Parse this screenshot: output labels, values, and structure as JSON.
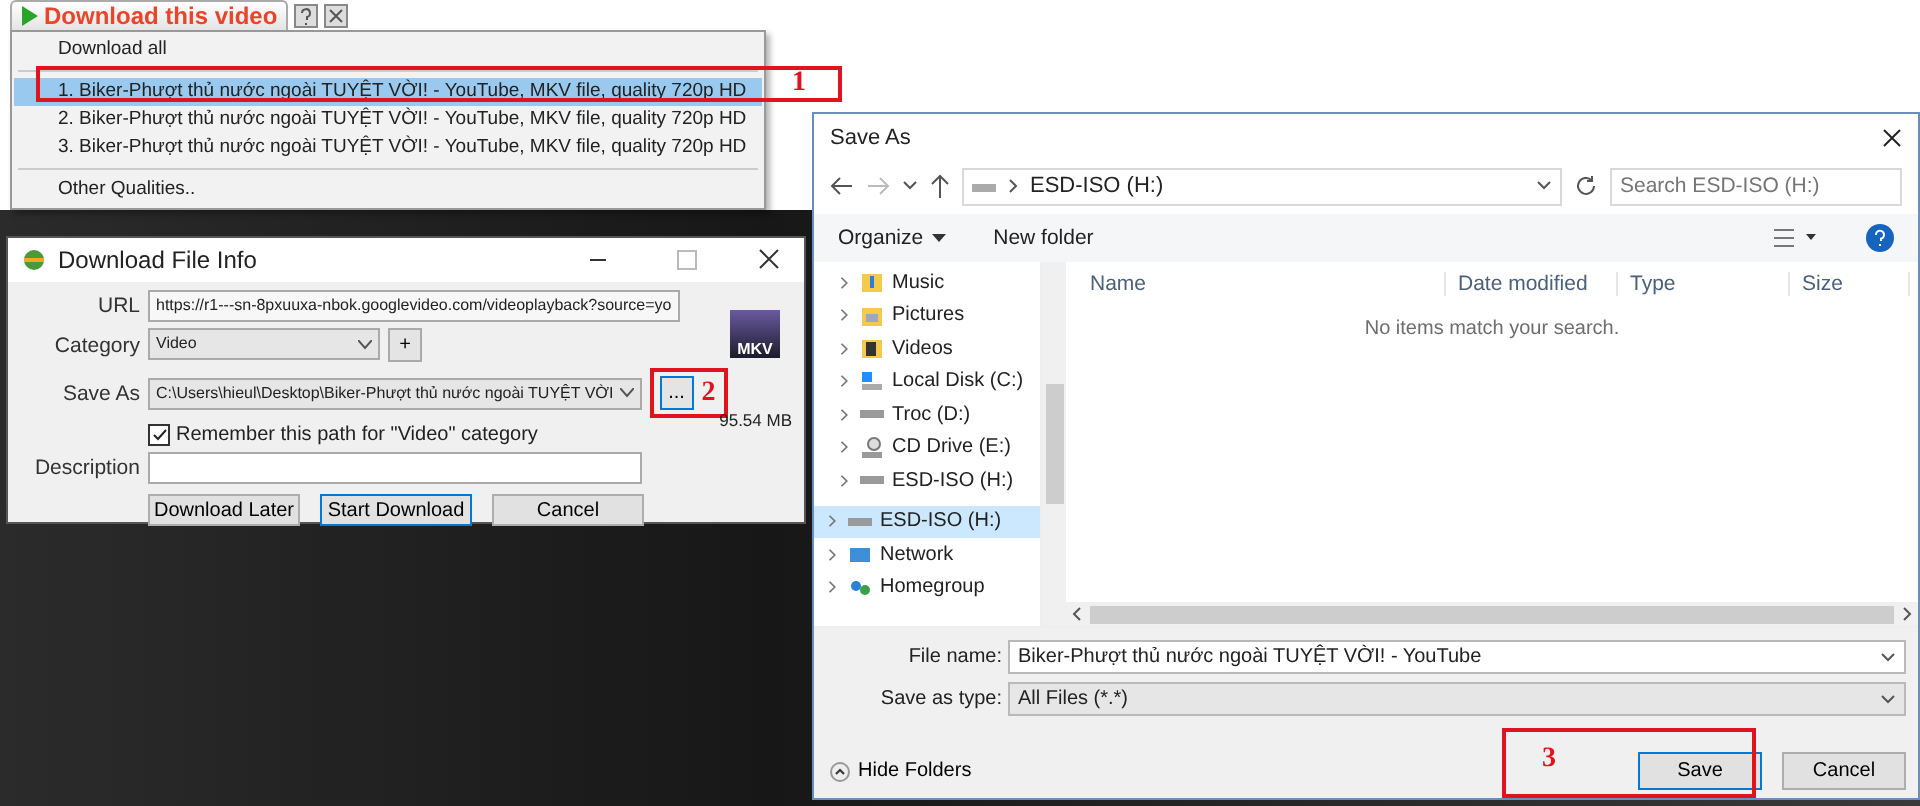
{
  "video_menu": {
    "title": "Download this video",
    "items": [
      {
        "kind": "all",
        "label": "Download all",
        "selected": false
      },
      {
        "kind": "quality",
        "label": "1.  Biker-Phượt thủ nước ngoài TUYỆT VỜI! - YouTube,  MKV file, quality 720p HD",
        "selected": true
      },
      {
        "kind": "quality",
        "label": "2.  Biker-Phượt thủ nước ngoài TUYỆT VỜI! - YouTube,  MKV file, quality 720p HD",
        "selected": false
      },
      {
        "kind": "quality",
        "label": "3.  Biker-Phượt thủ nước ngoài TUYỆT VỜI! - YouTube,  MKV file, quality 720p HD",
        "selected": false
      },
      {
        "kind": "more",
        "label": "Other Qualities..",
        "selected": false
      }
    ],
    "callout": "1"
  },
  "download_dialog": {
    "title": "Download File Info",
    "url": {
      "label": "URL",
      "value": "https://r1---sn-8pxuuxa-nbok.googlevideo.com/videoplayback?source=yo"
    },
    "category": {
      "label": "Category",
      "value": "Video",
      "add": "+"
    },
    "save_as": {
      "label": "Save As",
      "value": "C:\\Users\\hieul\\Desktop\\Biker-Phượt thủ nước ngoài TUYỆT VỜI",
      "browse": "...",
      "callout": "2"
    },
    "file_badge": "MKV",
    "size": "95.54  MB",
    "remember": {
      "label": "Remember this path for \"Video\" category",
      "checked": true
    },
    "description": {
      "label": "Description"
    },
    "buttons": [
      {
        "label": "Download Later",
        "default": false
      },
      {
        "label": "Start Download",
        "default": true
      },
      {
        "label": "Cancel",
        "default": false
      }
    ]
  },
  "save_dialog": {
    "title": "Save As",
    "path": "ESD-ISO (H:)",
    "search": {
      "placeholder": "Search ESD-ISO (H:)"
    },
    "toolbar": {
      "organize": "Organize",
      "new_folder": "New folder"
    },
    "nav_pane": {
      "children": [
        {
          "kind": "music",
          "label": "Music",
          "selected": false
        },
        {
          "kind": "pictures",
          "label": "Pictures",
          "selected": false
        },
        {
          "kind": "videos",
          "label": "Videos",
          "selected": false
        },
        {
          "kind": "system-disk",
          "label": "Local Disk (C:)",
          "selected": false
        },
        {
          "kind": "drive",
          "label": "Troc (D:)",
          "selected": false
        },
        {
          "kind": "cd",
          "label": "CD Drive (E:)",
          "selected": false
        },
        {
          "kind": "drive",
          "label": "ESD-ISO (H:)",
          "selected": false
        }
      ],
      "items": [
        {
          "kind": "drive",
          "label": "ESD-ISO (H:)",
          "selected": true
        },
        {
          "kind": "network",
          "label": "Network",
          "selected": false
        },
        {
          "kind": "homegroup",
          "label": "Homegroup",
          "selected": false
        }
      ]
    },
    "columns": [
      "Name",
      "Date modified",
      "Type",
      "Size"
    ],
    "empty_message": "No items match your search.",
    "file_name": {
      "label": "File name:",
      "value": "Biker-Phượt thủ nước ngoài TUYỆT VỜI! - YouTube"
    },
    "save_type": {
      "label": "Save as type:",
      "value": "All Files (*.*)"
    },
    "hide_folders": "Hide Folders",
    "buttons": [
      {
        "label": "Save",
        "default": true
      },
      {
        "label": "Cancel",
        "default": false
      }
    ],
    "callout": "3"
  }
}
